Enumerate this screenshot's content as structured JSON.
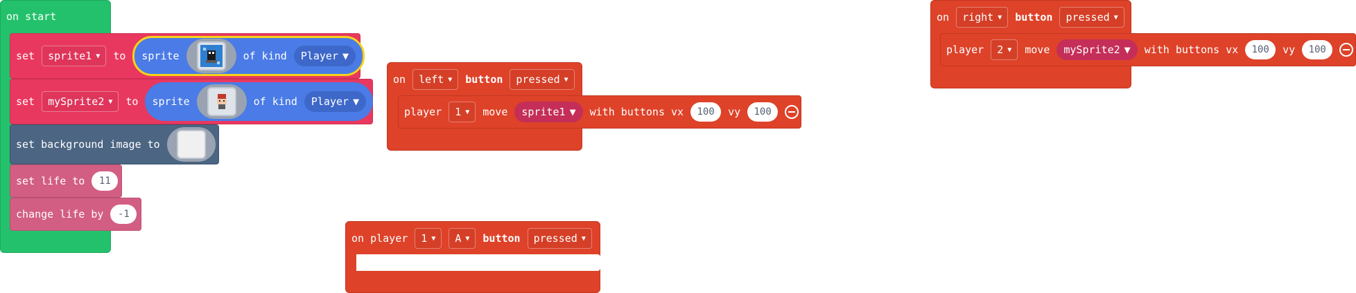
{
  "on_start": {
    "label": "on start",
    "set1": {
      "set": "set",
      "var": "sprite1",
      "to": "to",
      "sprite": "sprite",
      "of_kind": "of kind",
      "kind": "Player"
    },
    "set2": {
      "set": "set",
      "var": "mySprite2",
      "to": "to",
      "sprite": "sprite",
      "of_kind": "of kind",
      "kind": "Player"
    },
    "bg": {
      "label": "set background image to"
    },
    "life": {
      "label": "set life to",
      "value": "11"
    },
    "change": {
      "label": "change life by",
      "value": "-1"
    }
  },
  "left_event": {
    "on": "on",
    "button_name": "left",
    "button": "button",
    "state": "pressed",
    "move": {
      "player": "player",
      "player_num": "1",
      "move": "move",
      "sprite": "sprite1",
      "with": "with buttons vx",
      "vx": "100",
      "vy_label": "vy",
      "vy": "100"
    }
  },
  "right_event": {
    "on": "on",
    "button_name": "right",
    "button": "button",
    "state": "pressed",
    "move": {
      "player": "player",
      "player_num": "2",
      "move": "move",
      "sprite": "mySprite2",
      "with": "with buttons vx",
      "vx": "100",
      "vy_label": "vy",
      "vy": "100"
    }
  },
  "player_event": {
    "on_player": "on player",
    "player_num": "1",
    "button_name": "A",
    "button": "button",
    "state": "pressed"
  },
  "colors": {
    "events": "#de4229",
    "loops": "#23c16b",
    "sprites": "#e9385f",
    "scene": "#4b6582",
    "info": "#d35e83",
    "sprite_block": "#4a7be6"
  },
  "icons": [
    "dropdown-arrow-icon",
    "remove-arg-icon"
  ]
}
